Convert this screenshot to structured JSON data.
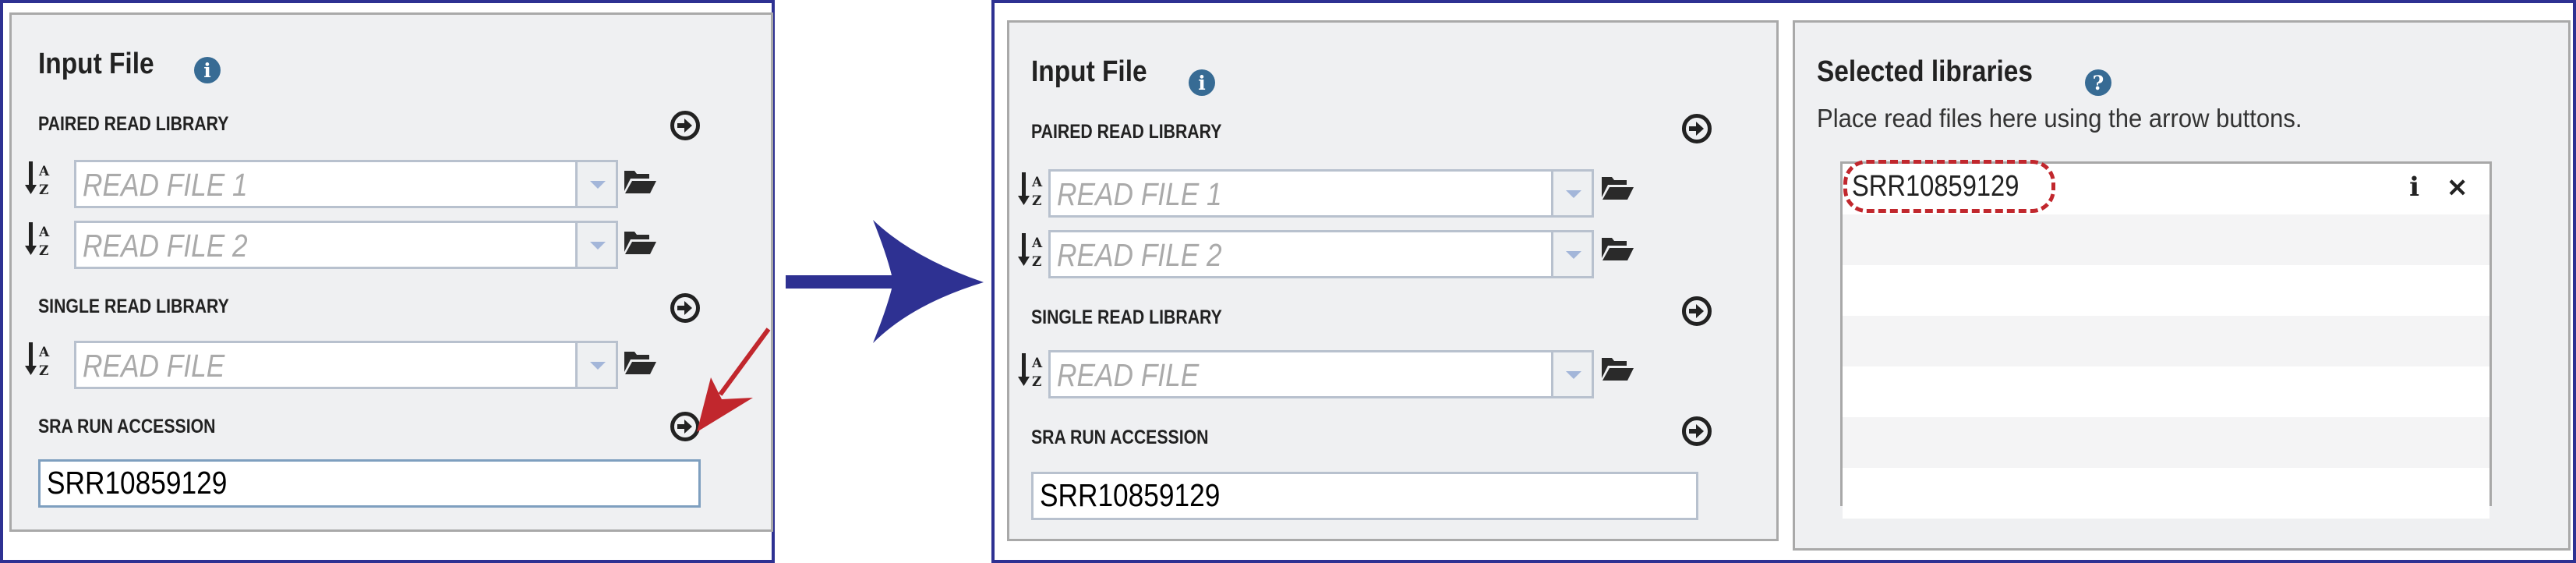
{
  "before": {
    "input_panel": {
      "title": "Input File",
      "info_icon": "info-icon",
      "paired": {
        "label": "PAIRED READ LIBRARY",
        "read_file_1_placeholder": "READ FILE 1",
        "read_file_2_placeholder": "READ FILE 2"
      },
      "single": {
        "label": "SINGLE READ LIBRARY",
        "read_file_placeholder": "READ FILE"
      },
      "sra": {
        "label": "SRA RUN ACCESSION",
        "value": "SRR10859129"
      }
    },
    "annotation": {
      "pointer": "red-arrow-pointing-to-sra-add-button",
      "color": "#c1272d"
    }
  },
  "transition_arrow": {
    "color": "#2e3192"
  },
  "after": {
    "input_panel": {
      "title": "Input File",
      "info_icon": "info-icon",
      "paired": {
        "label": "PAIRED READ LIBRARY",
        "read_file_1_placeholder": "READ FILE 1",
        "read_file_2_placeholder": "READ FILE 2"
      },
      "single": {
        "label": "SINGLE READ LIBRARY",
        "read_file_placeholder": "READ FILE"
      },
      "sra": {
        "label": "SRA RUN ACCESSION",
        "value": "SRR10859129"
      }
    },
    "selected_panel": {
      "title": "Selected libraries",
      "help_icon": "help-icon",
      "subtitle": "Place read files here using the arrow buttons.",
      "libraries": [
        {
          "name": "SRR10859129",
          "info_label": "i",
          "remove_label": "✕"
        }
      ],
      "empty_rows": 6
    }
  },
  "colors": {
    "frame": "#2e3192",
    "panel_bg": "#eff0f2",
    "info_badge": "#376b94",
    "highlight": "#c1272d"
  }
}
